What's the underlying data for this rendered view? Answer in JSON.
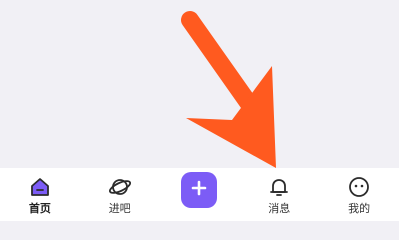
{
  "tabbar": {
    "items": [
      {
        "key": "home",
        "label": "首页",
        "icon": "home-icon",
        "active": true
      },
      {
        "key": "explore",
        "label": "进吧",
        "icon": "planet-icon",
        "active": false
      },
      {
        "key": "publish",
        "label": "",
        "icon": "plus-icon",
        "active": false
      },
      {
        "key": "messages",
        "label": "消息",
        "icon": "bell-icon",
        "active": false
      },
      {
        "key": "profile",
        "label": "我的",
        "icon": "smiley-face-icon",
        "active": false
      }
    ]
  },
  "colors": {
    "background": "#f1f0f5",
    "tabbar_background": "#ffffff",
    "accent_purple": "#7c5cf6",
    "annotation_arrow": "#ff5a1f"
  }
}
